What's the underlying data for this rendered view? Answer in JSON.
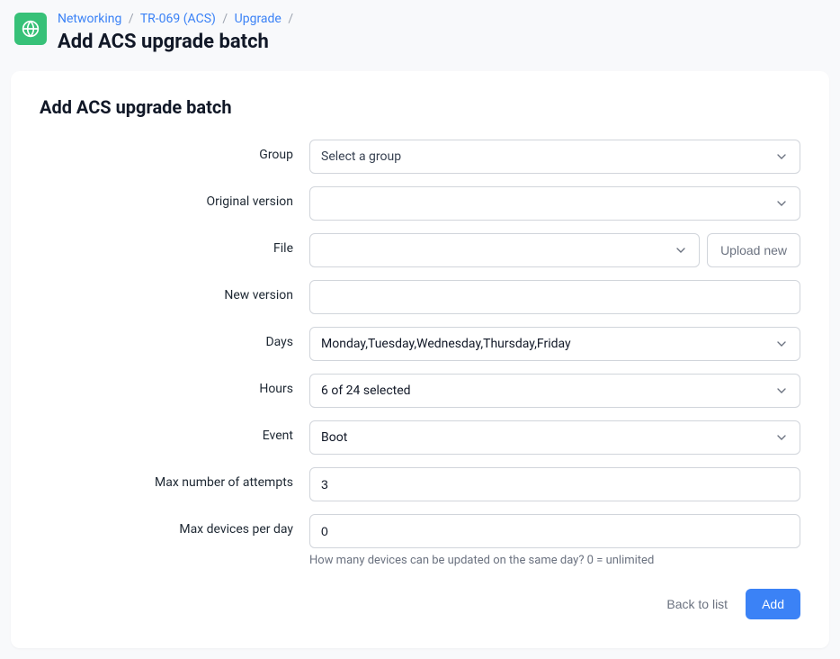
{
  "breadcrumb": {
    "items": [
      {
        "label": "Networking"
      },
      {
        "label": "TR-069 (ACS)"
      },
      {
        "label": "Upgrade"
      }
    ]
  },
  "page_title": "Add ACS upgrade batch",
  "card_title": "Add ACS upgrade batch",
  "form": {
    "group": {
      "label": "Group",
      "placeholder": "Select a group",
      "value": ""
    },
    "original_version": {
      "label": "Original version",
      "value": ""
    },
    "file": {
      "label": "File",
      "value": "",
      "upload_label": "Upload new"
    },
    "new_version": {
      "label": "New version",
      "value": ""
    },
    "days": {
      "label": "Days",
      "value": "Monday,Tuesday,Wednesday,Thursday,Friday"
    },
    "hours": {
      "label": "Hours",
      "value": "6 of 24 selected"
    },
    "event": {
      "label": "Event",
      "value": "Boot"
    },
    "max_attempts": {
      "label": "Max number of attempts",
      "value": "3"
    },
    "max_devices": {
      "label": "Max devices per day",
      "value": "0",
      "help": "How many devices can be updated on the same day? 0 = unlimited"
    }
  },
  "actions": {
    "back": "Back to list",
    "add": "Add"
  }
}
